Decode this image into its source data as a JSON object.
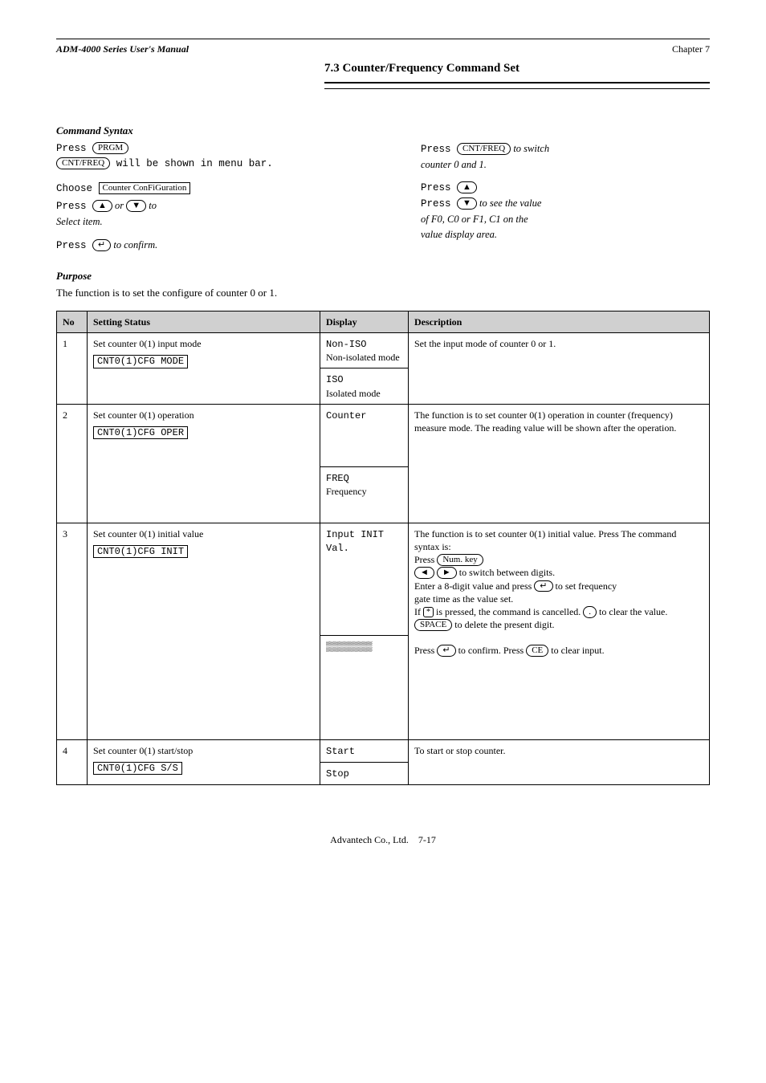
{
  "header": {
    "manual_title": "ADM-4000 Series User's Manual",
    "chapter": "Chapter 7"
  },
  "section": {
    "number": "7.3",
    "title": "Counter/Frequency Command Set"
  },
  "intro": {
    "heading": "Command Syntax",
    "left": {
      "line1_pre": "Press ",
      "line1_key": "PRGM",
      "line2_key1": "CNT/FREQ",
      "line2_post": " will be shown in menu bar.",
      "line3_pre": "Choose ",
      "line3_disp": "Counter ConFiGuration",
      "line4_pre": "Press ",
      "line4_key1": "▲",
      "line4_mid": " or ",
      "line4_key2": "▼",
      "line4_post": " to",
      "line5": "Select item.",
      "line6_pre": "Press ",
      "line6_key": "↵",
      "line6_post": " to confirm."
    },
    "right": {
      "line1_pre": "Press ",
      "line1_key": "CNT/FREQ",
      "line1_post": " to switch",
      "line2": "counter 0 and 1.",
      "line3_pre": "Press ",
      "line3_key": "▲",
      "line4_pre": "Press ",
      "line4_key": "▼",
      "line4_post": " to see the value",
      "line5_a": "of F0, C0 or F1, C1 on the",
      "line5_b": "value display area."
    }
  },
  "purpose_heading": "Purpose",
  "purpose_text": "The function is to set the configure of counter 0 or 1.",
  "table": {
    "headers": [
      "No",
      "Setting Status",
      "Display",
      "Description"
    ],
    "rows": [
      {
        "no": "1",
        "setting": "Set counter 0(1) input mode",
        "syntax": "CNT0(1)CFG MODE",
        "displays": [
          {
            "code": "Non-ISO",
            "desc": "Non-isolated mode"
          },
          {
            "code": "ISO",
            "desc": "Isolated mode"
          }
        ],
        "desc_text": "Set the input mode of counter 0 or 1."
      },
      {
        "no": "2",
        "setting": "Set counter 0(1) operation",
        "syntax": "CNT0(1)CFG OPER",
        "displays": [
          {
            "code": "Counter",
            "desc": ""
          },
          {
            "code": "FREQ",
            "desc": "Frequency"
          }
        ],
        "desc_text": "The function is to set counter 0(1) operation in counter (frequency) measure mode. The reading value will be shown after the operation."
      },
      {
        "no": "3",
        "setting": "Set counter 0(1) initial value",
        "syntax": "CNT0(1)CFG INIT",
        "displays": [
          {
            "code": "Input INIT Val.",
            "desc": ""
          },
          {
            "code": "▒▒▒▒▒▒▒▒",
            "desc": ""
          }
        ],
        "desc_text_lines": [
          "The function is to set counter 0(1) initial value. Press ",
          "The command syntax is:",
          "Press ",
          " to switch between digits.",
          "Enter a 8-digit value and press ",
          " to set frequency",
          "gate time as the value set.",
          "If ",
          " is pressed, the command is cancelled. ",
          " to clear the value. ",
          " to delete the present digit.",
          "Press ",
          " to confirm. Press ",
          " to clear input."
        ],
        "keys": {
          "numkey": "Num. key",
          "left": "◄",
          "right": "►",
          "enter": "↵",
          "star": "*",
          "dot": ".",
          "space": "SPACE",
          "enter2": "↵",
          "ce": "CE"
        }
      },
      {
        "no": "4",
        "setting": "Set counter 0(1) start/stop",
        "syntax": "CNT0(1)CFG S/S",
        "displays": [
          {
            "code": "Start",
            "desc": ""
          },
          {
            "code": "Stop",
            "desc": ""
          }
        ],
        "desc_text": "To start or stop counter."
      }
    ]
  },
  "footer": {
    "pub": "Advantech Co., Ltd.",
    "page": "7-17"
  }
}
